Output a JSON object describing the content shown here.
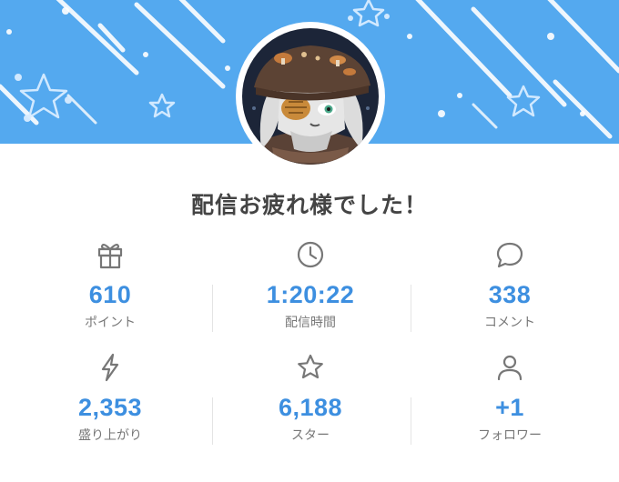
{
  "banner": {
    "color": "#54a9ef",
    "decorations": [
      "star-outline-icon",
      "diagonal-streaks"
    ]
  },
  "avatar": {
    "icon": "avatar-character-icon"
  },
  "title": "配信お疲れ様でした！",
  "accent_color": "#3d8fe0",
  "stats": [
    {
      "icon": "gift-icon",
      "value": "610",
      "label": "ポイント"
    },
    {
      "icon": "clock-icon",
      "value": "1:20:22",
      "label": "配信時間"
    },
    {
      "icon": "speech-bubble-icon",
      "value": "338",
      "label": "コメント"
    },
    {
      "icon": "lightning-icon",
      "value": "2,353",
      "label": "盛り上がり"
    },
    {
      "icon": "star-icon",
      "value": "6,188",
      "label": "スター"
    },
    {
      "icon": "person-icon",
      "value": "+1",
      "label": "フォロワー"
    }
  ]
}
